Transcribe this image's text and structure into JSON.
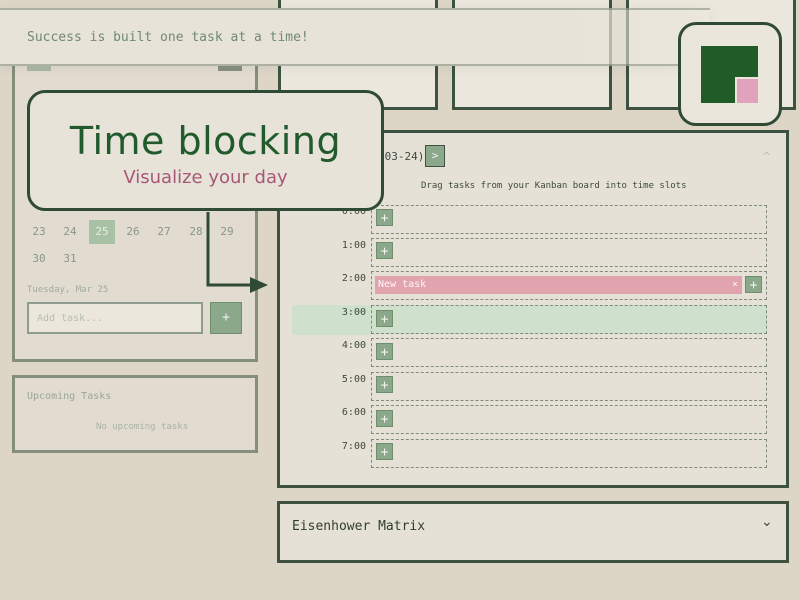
{
  "banner": {
    "motto": "Success is built one task at a time!"
  },
  "callout": {
    "title": "Time blocking",
    "subtitle": "Visualize your day"
  },
  "calendar": {
    "week_row": [
      "23",
      "24",
      "25",
      "26",
      "27",
      "28",
      "29"
    ],
    "last_row": [
      "30",
      "31"
    ],
    "selected_day": "25",
    "selected_date_label": "Tuesday, Mar 25",
    "add_task_placeholder": "Add task...",
    "add_button": "+"
  },
  "upcoming": {
    "title": "Upcoming Tasks",
    "empty_text": "No upcoming tasks"
  },
  "time_blocking": {
    "date_fragment": "-03-24)",
    "next_button": ">",
    "collapse_icon": "^",
    "instruction": "Drag tasks from your Kanban board into time slots",
    "partial_label": "0:00",
    "hours": [
      "1:00",
      "2:00",
      "3:00",
      "4:00",
      "5:00",
      "6:00",
      "7:00"
    ],
    "add_label": "+",
    "task": {
      "label": "New task",
      "remove": "×",
      "color": "#e1a4ae"
    }
  },
  "eisenhower": {
    "title": "Eisenhower Matrix",
    "expand_icon": "⌄"
  },
  "colors": {
    "accent": "#215a2c",
    "pink": "#a85876",
    "slot_add": "#8ba98a",
    "panel_border": "#3e5241"
  }
}
